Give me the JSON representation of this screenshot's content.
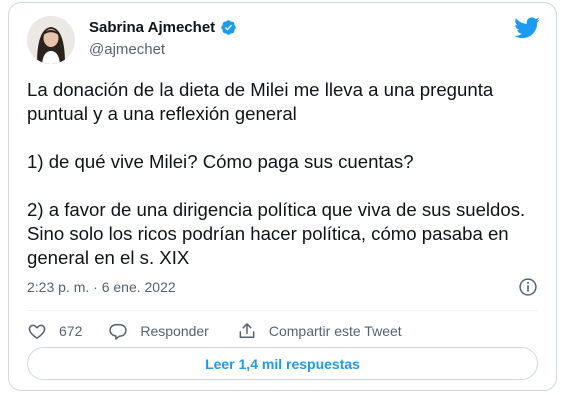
{
  "author": {
    "name": "Sabrina Ajmechet",
    "handle": "@ajmechet"
  },
  "tweet": {
    "paragraphs": [
      "La donación de la dieta de Milei me lleva a una pregunta puntual y a una reflexión general",
      "1) de qué vive Milei? Cómo paga sus cuentas?",
      "2) a favor de una dirigencia política que viva de sus sueldos. Sino solo los ricos podrían hacer política, cómo pasaba en general en el s. XIX"
    ],
    "timestamp": "2:23 p. m. · 6 ene. 2022"
  },
  "actions": {
    "like_count": "672",
    "reply_label": "Responder",
    "share_label": "Compartir este Tweet"
  },
  "replies_button": {
    "label": "Leer 1,4 mil respuestas"
  },
  "colors": {
    "accent": "#1d9bf0",
    "secondary_text": "#536471",
    "border": "#cfd9de"
  }
}
